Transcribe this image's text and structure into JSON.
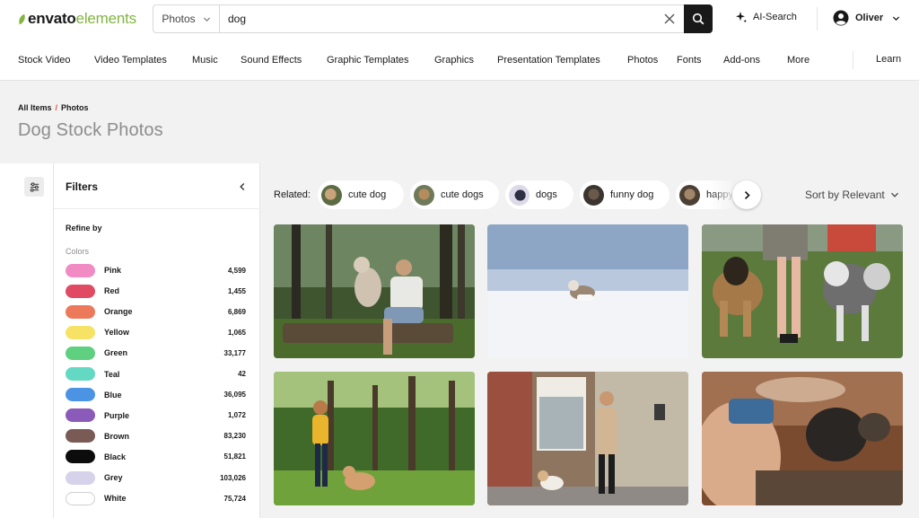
{
  "brand": {
    "word1": "envato",
    "word2": "elements"
  },
  "search": {
    "scope": "Photos",
    "query": "dog",
    "placeholder": ""
  },
  "header": {
    "ai_search": "AI-Search",
    "user_name": "Oliver"
  },
  "nav": {
    "items": [
      "Stock Video",
      "Video Templates",
      "Music",
      "Sound Effects",
      "Graphic Templates",
      "Graphics",
      "Presentation Templates",
      "Photos",
      "Fonts",
      "Add-ons",
      "More"
    ],
    "learn": "Learn"
  },
  "breadcrumb": {
    "root": "All Items",
    "separator": "/",
    "current": "Photos"
  },
  "page_title": "Dog Stock Photos",
  "filters": {
    "title": "Filters",
    "refine_by": "Refine by",
    "colors_label": "Colors",
    "colors": [
      {
        "name": "Pink",
        "count": "4,599",
        "hex": "#f08cc3"
      },
      {
        "name": "Red",
        "count": "1,455",
        "hex": "#e04a62"
      },
      {
        "name": "Orange",
        "count": "6,869",
        "hex": "#ec7a5a"
      },
      {
        "name": "Yellow",
        "count": "1,065",
        "hex": "#f6e365"
      },
      {
        "name": "Green",
        "count": "33,177",
        "hex": "#5fcf80"
      },
      {
        "name": "Teal",
        "count": "42",
        "hex": "#63d8c3"
      },
      {
        "name": "Blue",
        "count": "36,095",
        "hex": "#4b94e3"
      },
      {
        "name": "Purple",
        "count": "1,072",
        "hex": "#8a5bb8"
      },
      {
        "name": "Brown",
        "count": "83,230",
        "hex": "#7a5a55"
      },
      {
        "name": "Black",
        "count": "51,821",
        "hex": "#0c0c0c"
      },
      {
        "name": "Grey",
        "count": "103,026",
        "hex": "#d6d2ea"
      },
      {
        "name": "White",
        "count": "75,724",
        "hex": "#ffffff"
      }
    ]
  },
  "related": {
    "label": "Related:",
    "chips": [
      "cute dog",
      "cute dogs",
      "dogs",
      "funny dog",
      "happy"
    ]
  },
  "sort": {
    "label": "Sort by Relevant"
  },
  "photos": [
    {
      "name": "photo-man-with-dog-in-forest"
    },
    {
      "name": "photo-dog-running-in-snow"
    },
    {
      "name": "photo-dogs-on-leashes-walk"
    },
    {
      "name": "photo-woman-with-dog-in-park"
    },
    {
      "name": "photo-woman-walking-dog-on-street"
    },
    {
      "name": "photo-dog-with-person-on-couch"
    }
  ],
  "colors": {
    "accent_green": "#82b541",
    "breadcrumb_separator": "#e54a2d"
  }
}
